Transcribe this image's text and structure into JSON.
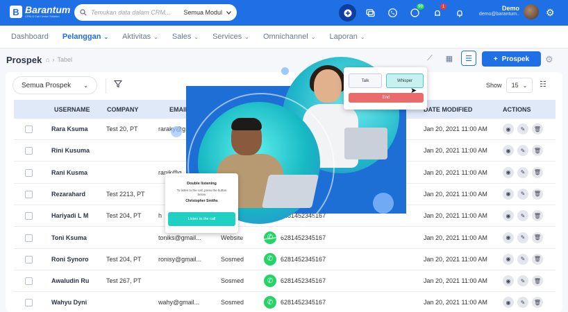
{
  "header": {
    "brand": "Barantum",
    "brand_sub": "CRM & Call Center Solution",
    "search_placeholder": "Temukan data dalam CRM...",
    "search_module": "Semua Modul",
    "user_name": "Demo",
    "user_email": "demo@barantum..",
    "badge_whatsapp": "99",
    "badge_notifications": "1"
  },
  "nav": {
    "items": [
      {
        "label": "Dashboard"
      },
      {
        "label": "Pelanggan"
      },
      {
        "label": "Aktivitas"
      },
      {
        "label": "Sales"
      },
      {
        "label": "Services"
      },
      {
        "label": "Omnichannel"
      },
      {
        "label": "Laporan"
      }
    ]
  },
  "page": {
    "title": "Prospek",
    "breadcrumb": "Tabel",
    "add_button": "Prospek",
    "filter_select": "Semua Prospek",
    "show_label": "Show",
    "show_value": "15"
  },
  "table": {
    "headers": [
      "USERNAME",
      "COMPANY",
      "EMAIL",
      "DATE MODIFIED",
      "ACTIONS"
    ],
    "rows": [
      {
        "username": "Rara Ksuma",
        "company": "Test 20, PT",
        "email": "raraky@g",
        "source": "",
        "phone": "",
        "date": "Jan 20, 2021 11:00 AM"
      },
      {
        "username": "Rini Kusuma",
        "company": "",
        "email": "",
        "source": "",
        "phone": "",
        "date": "Jan 20, 2021 11:00 AM"
      },
      {
        "username": "Rani Kusma",
        "company": "",
        "email": "ranik@g",
        "source": "",
        "phone": "",
        "date": "Jan 20, 2021 11:00 AM"
      },
      {
        "username": "Rezarahard",
        "company": "Test 2213, PT",
        "email": "",
        "source": "",
        "phone": "",
        "date": "Jan 20, 2021 11:00 AM"
      },
      {
        "username": "Hariyadi L M",
        "company": "Test 204, PT",
        "email": "h",
        "source": "",
        "phone": "6281452345167",
        "date": "Jan 20, 2021 11:00 AM"
      },
      {
        "username": "Toni Ksuma",
        "company": "",
        "email": "toniks@gmail...",
        "source": "Website",
        "phone": "6281452345167",
        "date": "Jan 20, 2021 11:00 AM"
      },
      {
        "username": "Roni Synoro",
        "company": "Test 204, PT",
        "email": "ronisy@gmail...",
        "source": "Sosmed",
        "phone": "6281452345167",
        "date": "Jan 20, 2021 11:00 AM"
      },
      {
        "username": "Awaludin Ru",
        "company": "Test 267, PT",
        "email": "",
        "source": "Sosmed",
        "phone": "6281452345167",
        "date": "Jan 20, 2021 11:00 AM"
      },
      {
        "username": "Wahyu Dyni",
        "company": "",
        "email": "wahy@gmail...",
        "source": "Sosmed",
        "phone": "6281452345167",
        "date": "Jan 20, 2021 11:00 AM"
      }
    ]
  },
  "call_popup": {
    "talk": "Talk",
    "whisper": "Whisper",
    "end": "End"
  },
  "listen_popup": {
    "title": "Double listening",
    "description": "To listen to the call, press the button below",
    "agent": "Christopher Smiths",
    "button": "Listen to the call"
  },
  "colors": {
    "primary": "#1f6fe5",
    "whatsapp": "#25d366",
    "end_call": "#ea6b6b",
    "listen": "#1fd0c3"
  }
}
